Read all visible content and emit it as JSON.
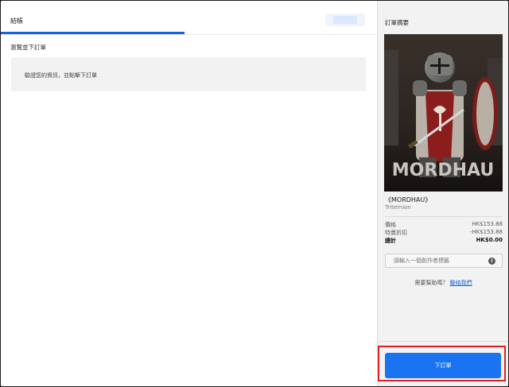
{
  "tabs": {
    "active_label": "結帳"
  },
  "main": {
    "section_title": "瀏覽並下訂單",
    "notice": "驗證您的資訊，並點擊下訂單"
  },
  "summary": {
    "title": "訂單摘要",
    "cover_text": "MORDHAU",
    "game_title": "《MORDHAU》",
    "publisher": "Triternion",
    "price_label": "價格",
    "price_value": "HK$153.88",
    "discount_label": "特賣折扣",
    "discount_value": "-HK$153.88",
    "total_label": "總計",
    "total_value": "HK$0.00",
    "creator_placeholder": "請輸入一個創作者標籤",
    "help_text": "需要幫助嗎？",
    "help_link": "聯絡我們"
  },
  "footer": {
    "place_order_label": "下訂單"
  },
  "colors": {
    "accent": "#1a73f0",
    "highlight": "#e02020"
  }
}
